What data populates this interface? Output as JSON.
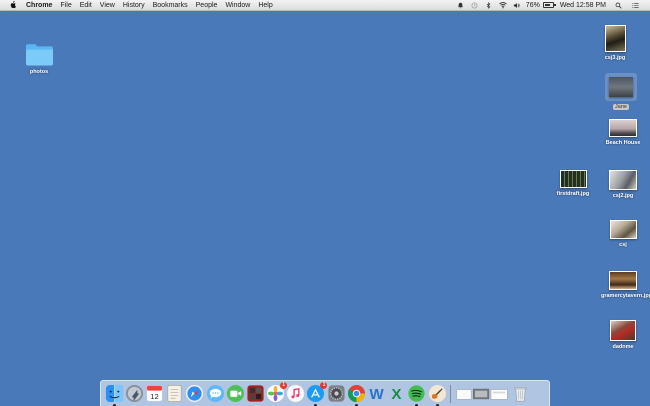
{
  "menubar": {
    "app_name": "Chrome",
    "items": [
      "File",
      "Edit",
      "View",
      "History",
      "Bookmarks",
      "People",
      "Window",
      "Help"
    ],
    "battery_percent": "76%",
    "clock": "Wed 12:58 PM",
    "battery_level": 0.76
  },
  "desktop": {
    "folder_photos": "photos",
    "files": {
      "csj3": "csj3.jpg",
      "jane": "Jane",
      "beach_house": "Beach House",
      "firstdraft": "firstdraft.jpg",
      "csj2": "csj2.jpg",
      "csj": "csj",
      "gramercy": "gramercytavern.jpg",
      "dadnme": "dadnme"
    }
  },
  "dock": {
    "badges": {
      "photos": "1",
      "appstore": "1"
    },
    "icons": [
      "finder-icon",
      "launchpad-icon",
      "calendar-icon",
      "contacts-icon",
      "safari-icon",
      "messages-icon",
      "facetime-icon",
      "photo-booth-icon",
      "photos-icon",
      "itunes-icon",
      "app-store-icon",
      "system-preferences-icon",
      "chrome-icon",
      "word-icon",
      "excel-icon",
      "spotify-icon",
      "garageband-icon",
      "downloads-stack-icon",
      "trash-icon"
    ],
    "calendar_day": "12",
    "colors": {
      "desktop": "#4a79b9"
    }
  }
}
